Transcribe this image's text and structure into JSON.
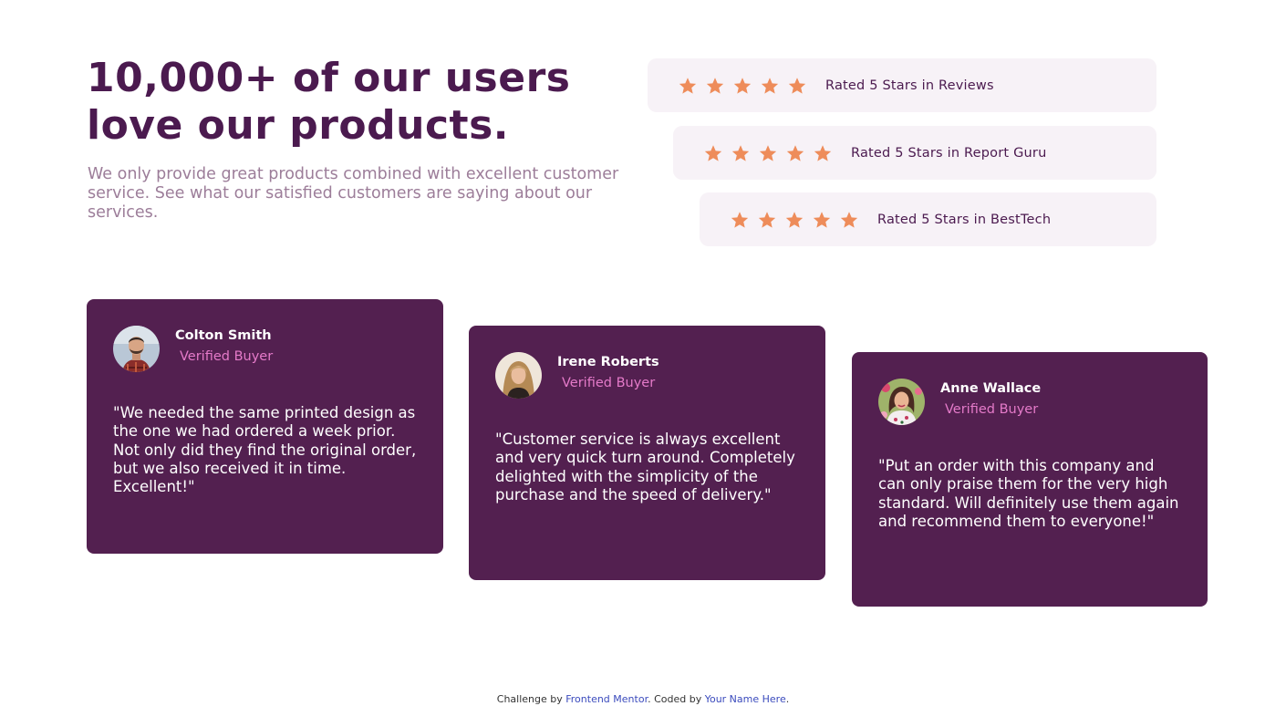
{
  "hero": {
    "title": "10,000+ of our users love our products.",
    "text": "We only provide great products combined with excellent customer service. See what our satisfied customers are saying about our services."
  },
  "ratings": [
    {
      "label": "Rated 5 Stars in Reviews",
      "stars": 5,
      "icon": "star-icon"
    },
    {
      "label": "Rated 5 Stars in Report Guru",
      "stars": 5,
      "icon": "star-icon"
    },
    {
      "label": "Rated 5 Stars in BestTech",
      "stars": 5,
      "icon": "star-icon"
    }
  ],
  "testimonials": [
    {
      "name": "Colton Smith",
      "badge": "Verified Buyer",
      "quote": "\"We needed the same printed design as the one we had ordered a week prior. Not only did they find the original order, but we also received it in time. Excellent!\""
    },
    {
      "name": "Irene Roberts",
      "badge": "Verified Buyer",
      "quote": "\"Customer service is always excellent and very quick turn around. Completely delighted with the simplicity of the purchase and the speed of delivery.\""
    },
    {
      "name": "Anne Wallace",
      "badge": "Verified Buyer",
      "quote": "\"Put an order with this company and can only praise them for the very high standard. Will definitely use them again and recommend them to everyone!\""
    }
  ],
  "colors": {
    "accent": "#4b1a4f",
    "card_bg": "#532050",
    "star": "#ee8c5a",
    "verified": "#e47ac9",
    "pill_bg": "#f7f2f7"
  },
  "attribution": {
    "prefix": "Challenge by",
    "link1": "Frontend Mentor",
    "middle": ". Coded by",
    "link2": "Your Name Here",
    "suffix": "."
  }
}
